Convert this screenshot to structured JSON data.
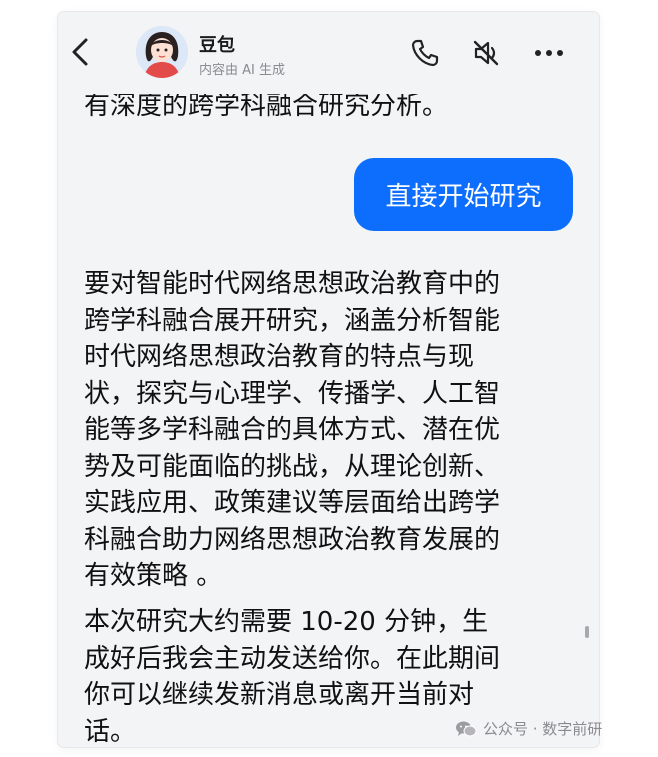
{
  "header": {
    "name": "豆包",
    "subtitle": "内容由 AI 生成",
    "icons": [
      "back-arrow-icon",
      "avatar",
      "phone-icon",
      "mute-icon",
      "more-icon"
    ]
  },
  "messages": {
    "partial_top": "有深度的跨学科融合研究分析。",
    "user_bubble": "直接开始研究",
    "reply_para1": [
      "要对智能时代网络思想政治教育中的",
      "跨学科融合展开研究，涵盖分析智能",
      "时代网络思想政治教育的特点与现",
      "状，探究与心理学、传播学、人工智",
      "能等多学科融合的具体方式、潜在优",
      "势及可能面临的挑战，从理论创新、",
      "实践应用、政策建议等层面给出跨学",
      "科融合助力网络思想政治教育发展的",
      "有效策略 。"
    ],
    "reply_para2": [
      "本次研究大约需要 10-20 分钟，生",
      "成好后我会主动发送给你。在此期间",
      "你可以继续发新消息或离开当前对",
      "话。"
    ]
  },
  "watermark": {
    "text": "公众号 · 数字前研",
    "icon": "wechat-icon"
  },
  "colors": {
    "accent": "#0d6efd",
    "background": "#f3f4f6",
    "subtext": "#8a8a8f"
  }
}
